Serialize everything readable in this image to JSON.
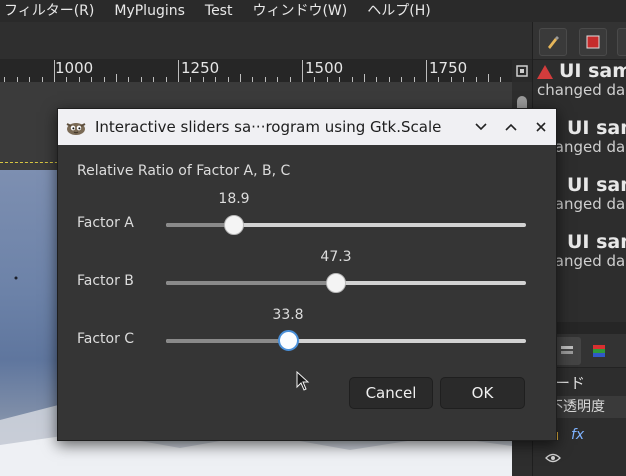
{
  "menubar": {
    "items": [
      "フィルター(R)",
      "MyPlugins",
      "Test",
      "ウィンドウ(W)",
      "ヘルプ(H)"
    ]
  },
  "ruler": {
    "labels": [
      "1000",
      "1250",
      "1500",
      "1750"
    ]
  },
  "dock": {
    "log_entries": [
      {
        "title": "UI sam",
        "subtitle": "changed da",
        "warning": true
      },
      {
        "title": "UI sam",
        "subtitle": "changed da",
        "warning": false
      },
      {
        "title": "UI sam",
        "subtitle": "changed da",
        "warning": false
      },
      {
        "title": "UI sam",
        "subtitle": "changed da",
        "warning": false
      }
    ],
    "mode_label": "ード",
    "opacity_label": "不透明度",
    "fx_label": "fx"
  },
  "dialog": {
    "title": "Interactive sliders sa···rogram using Gtk.Scale",
    "heading": "Relative Ratio of Factor A, B, C",
    "sliders": [
      {
        "label": "Factor A",
        "value": "18.9",
        "fraction": 0.189
      },
      {
        "label": "Factor B",
        "value": "47.3",
        "fraction": 0.473
      },
      {
        "label": "Factor C",
        "value": "33.8",
        "fraction": 0.338
      }
    ],
    "cancel_label": "Cancel",
    "ok_label": "OK"
  },
  "colors": {
    "focus_ring": "#4a90d9",
    "warning": "#d23c3c",
    "selection_border": "#d6c441"
  }
}
